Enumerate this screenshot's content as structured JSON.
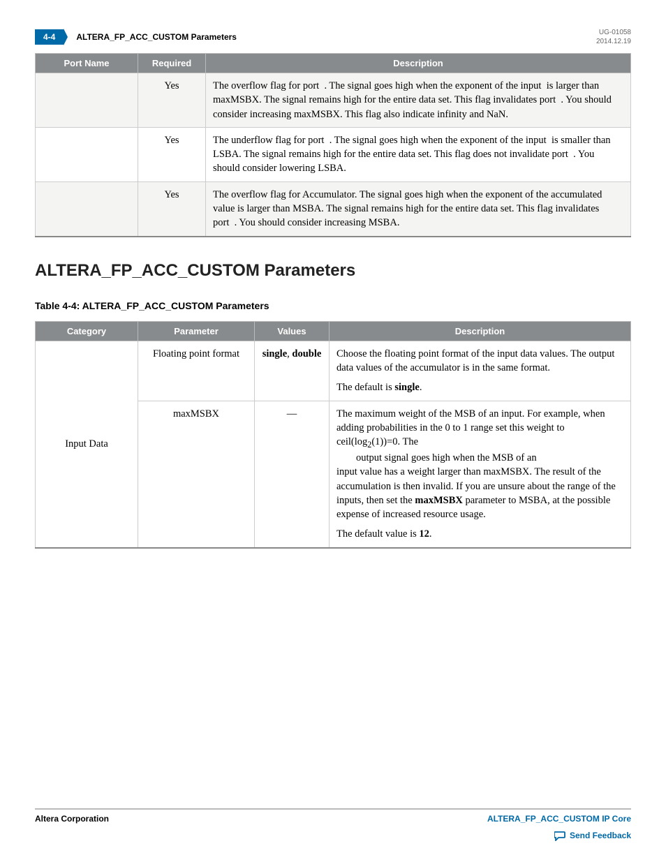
{
  "header": {
    "page_num": "4-4",
    "title": "ALTERA_FP_ACC_CUSTOM Parameters",
    "doc_id": "UG-01058",
    "doc_date": "2014.12.19"
  },
  "table1": {
    "headers": [
      "Port Name",
      "Required",
      "Description"
    ],
    "rows": [
      {
        "port": "",
        "required": "Yes",
        "desc": "The overflow flag for port  . The signal goes high when the exponent of the input  is larger than maxMSBX. The signal remains high for the entire data set. This flag invalidates port  . You should consider increasing maxMSBX. This flag also indicate infinity and NaN."
      },
      {
        "port": "",
        "required": "Yes",
        "desc": "The underflow flag for port  . The signal goes high when the exponent of the input  is smaller than LSBA. The signal remains high for the entire data set. This flag does not invalidate port  . You should consider lowering LSBA."
      },
      {
        "port": "",
        "required": "Yes",
        "desc": "The overflow flag for Accumulator. The signal goes high when the exponent of the accumulated value is larger than MSBA. The signal remains high for the entire data set. This flag invalidates port  . You should consider increasing MSBA."
      }
    ]
  },
  "section_heading": "ALTERA_FP_ACC_CUSTOM Parameters",
  "table2_caption": "Table 4-4: ALTERA_FP_ACC_CUSTOM Parameters",
  "table2": {
    "headers": [
      "Category",
      "Parameter",
      "Values",
      "Description"
    ],
    "category0": "Input Data",
    "rows": [
      {
        "parameter": "Floating point format",
        "values_pre": "single",
        "values_sep": ", ",
        "values_post": "double",
        "desc_main": "Choose the floating point format of the input data values. The output data values of the accumulator is in the same format.",
        "desc_default_pre": "The default is ",
        "desc_default_bold": "single",
        "desc_default_post": "."
      },
      {
        "parameter": "maxMSBX",
        "values_dash": "—",
        "desc_p1": "The maximum weight of the MSB of an input. For example, when adding probabilities in the 0 to 1 range set this weight to ceil(log",
        "desc_sub": "2",
        "desc_p1b": "(1))=0. The",
        "desc_indent": "output signal goes high when the MSB of an",
        "desc_p2a": "input value has a weight larger than maxMSBX. The result of the accumulation is then invalid. If you are unsure about the range of the inputs, then set the ",
        "desc_bold_param": "maxMSBX",
        "desc_p2b": " parameter to MSBA, at the possible expense of increased resource usage.",
        "desc_default_pre": "The default value is ",
        "desc_default_bold": "12",
        "desc_default_post": "."
      }
    ]
  },
  "footer": {
    "left": "Altera Corporation",
    "right": "ALTERA_FP_ACC_CUSTOM IP Core",
    "feedback": "Send Feedback"
  }
}
